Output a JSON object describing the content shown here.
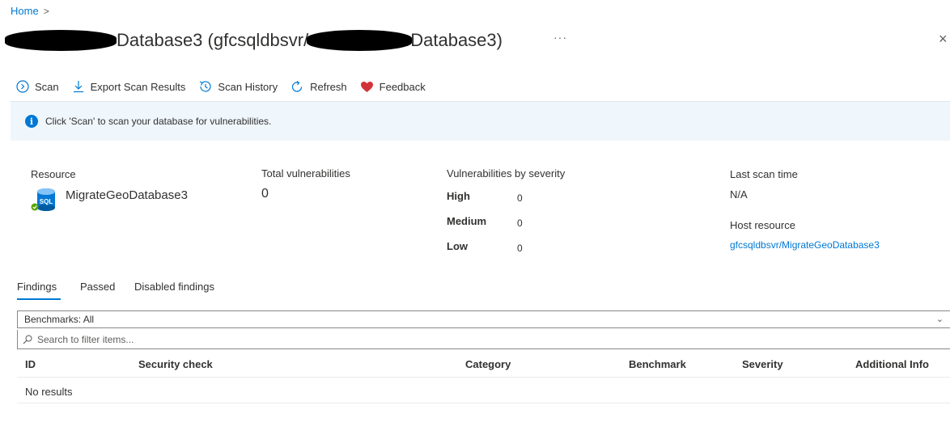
{
  "breadcrumb": {
    "home": "Home",
    "separator": ">"
  },
  "header": {
    "title_part1": "Database3 (gfcsqldbsvr/",
    "title_part2": "Database3)",
    "more": "···",
    "close": "×"
  },
  "toolbar": {
    "scan": "Scan",
    "export": "Export Scan Results",
    "history": "Scan History",
    "refresh": "Refresh",
    "feedback": "Feedback"
  },
  "info": {
    "message": "Click 'Scan' to scan your database for vulnerabilities."
  },
  "summary": {
    "resource_label": "Resource",
    "resource_name": "MigrateGeoDatabase3",
    "resource_icon_text": "SQL",
    "total_label": "Total vulnerabilities",
    "total_value": "0",
    "severity_label": "Vulnerabilities by severity",
    "severities": [
      {
        "name": "High",
        "value": "0"
      },
      {
        "name": "Medium",
        "value": "0"
      },
      {
        "name": "Low",
        "value": "0"
      }
    ],
    "last_scan_label": "Last scan time",
    "last_scan_value": "N/A",
    "host_label": "Host resource",
    "host_value": "gfcsqldbsvr/MigrateGeoDatabase3"
  },
  "tabs": [
    "Findings",
    "Passed",
    "Disabled findings"
  ],
  "filters": {
    "benchmarks": "Benchmarks: All",
    "search_placeholder": "Search to filter items..."
  },
  "table": {
    "columns": [
      "ID",
      "Security check",
      "Category",
      "Benchmark",
      "Severity",
      "Additional Info"
    ],
    "empty": "No results"
  },
  "colors": {
    "accent": "#0078d4",
    "info_bg": "#eff6fc",
    "feedback": "#d13438",
    "success": "#57a300"
  }
}
